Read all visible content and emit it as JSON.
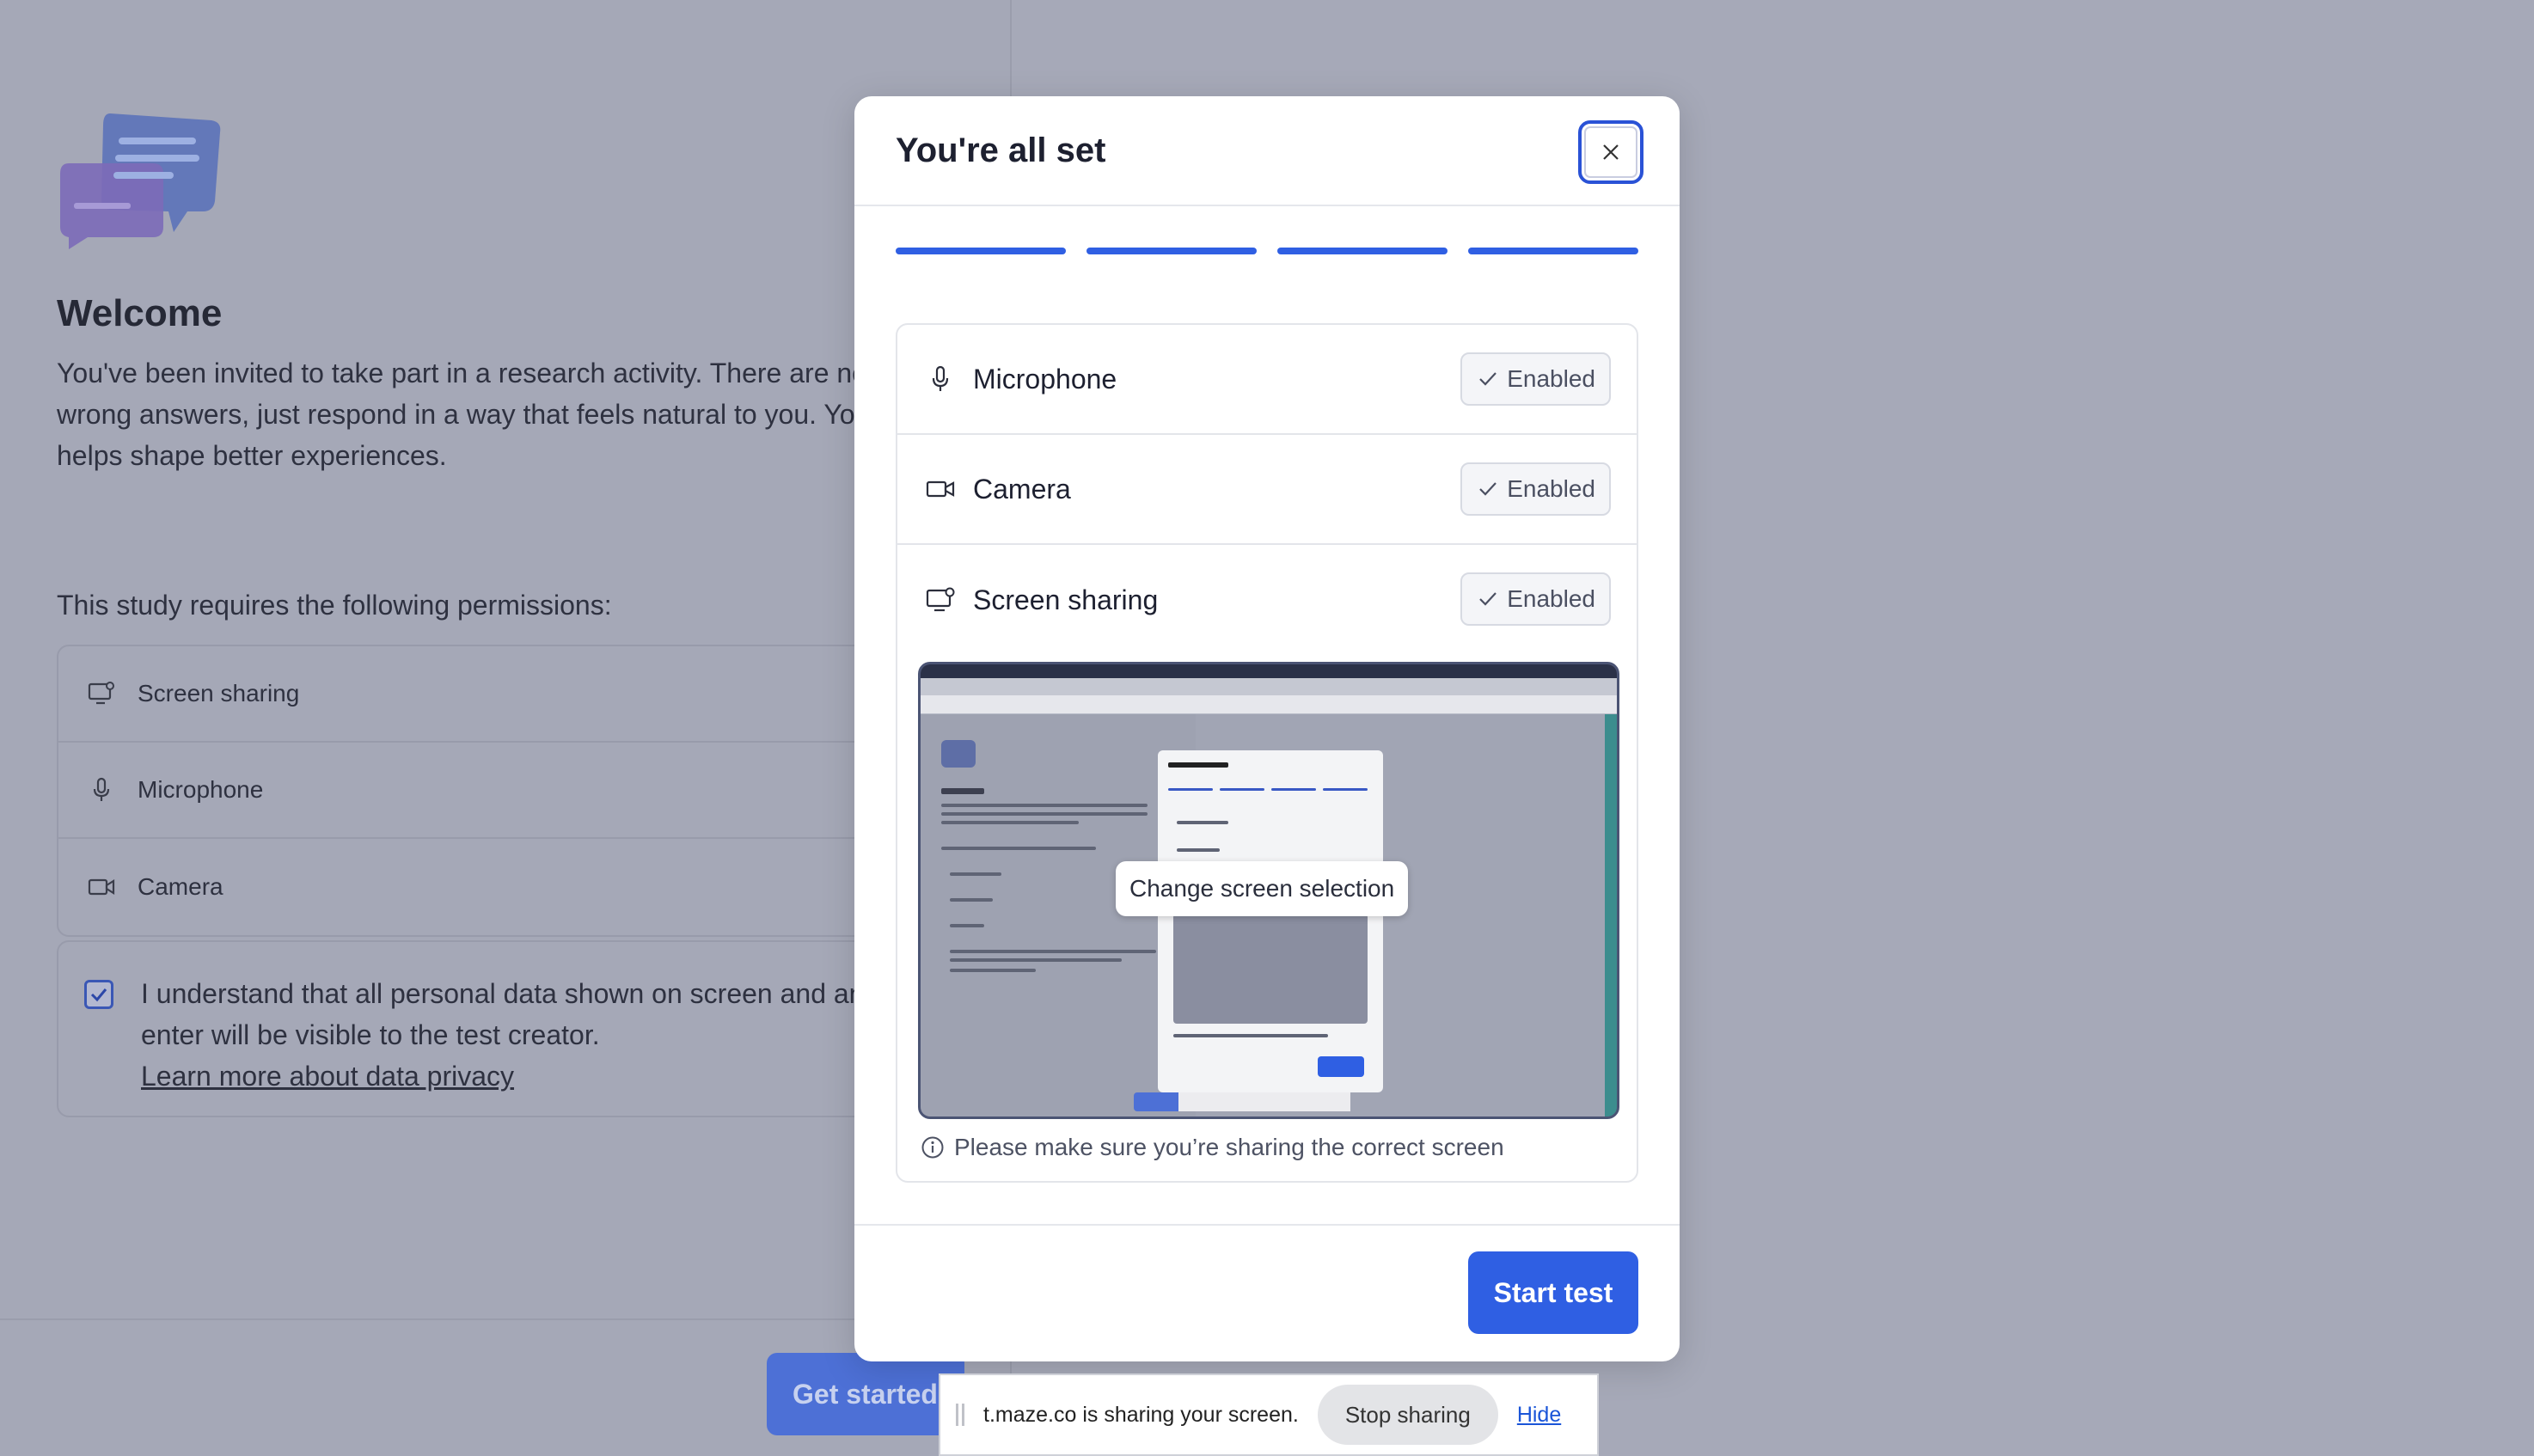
{
  "background": {
    "welcome_title": "Welcome",
    "welcome_text": "You've been invited to take part in a research activity. There are no right or wrong answers, just respond in a way that feels natural to you. Your input helps shape better experiences.",
    "permissions_intro": "This study requires the following permissions:",
    "permissions": [
      {
        "label": "Screen sharing",
        "icon": "screen-share-icon"
      },
      {
        "label": "Microphone",
        "icon": "microphone-icon"
      },
      {
        "label": "Camera",
        "icon": "camera-icon"
      }
    ],
    "consent_text": "I understand that all personal data shown on screen and any data I enter will be visible to the test creator.",
    "consent_link": "Learn more about data privacy",
    "get_started_label": "Get started"
  },
  "modal": {
    "title": "You're all set",
    "progress_steps": 4,
    "progress_completed": 4,
    "permissions": [
      {
        "label": "Microphone",
        "status": "Enabled",
        "icon": "microphone-icon"
      },
      {
        "label": "Camera",
        "status": "Enabled",
        "icon": "camera-icon"
      },
      {
        "label": "Screen sharing",
        "status": "Enabled",
        "icon": "screen-share-icon"
      }
    ],
    "preview_tooltip": "Change screen selection",
    "hint": "Please make sure you’re sharing the correct screen",
    "start_label": "Start test"
  },
  "share_bar": {
    "message": "t.maze.co is sharing your screen.",
    "stop_label": "Stop sharing",
    "hide_label": "Hide"
  },
  "colors": {
    "accent": "#2f5fe3",
    "overlay": "#a6a9b8"
  }
}
